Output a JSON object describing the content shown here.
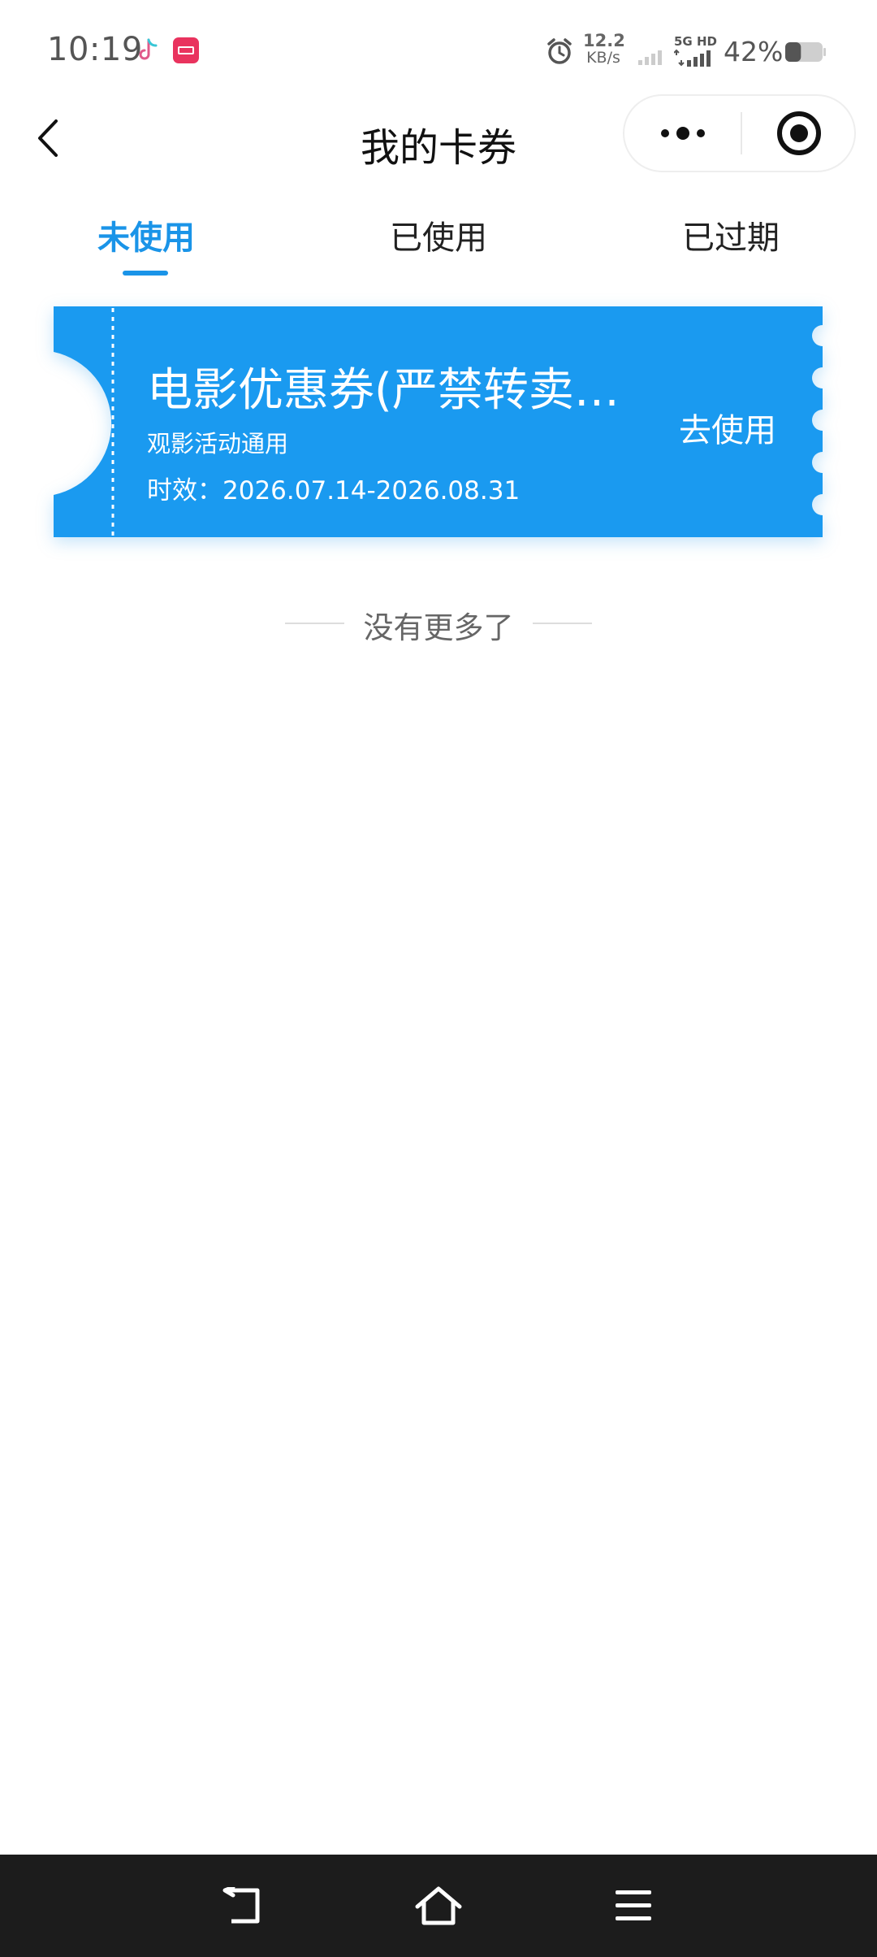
{
  "status_bar": {
    "time": "10:19",
    "net_speed_value": "12.2",
    "net_speed_unit": "KB/s",
    "network_label": "5G HD",
    "battery_percent": "42%",
    "battery_level": 0.42,
    "icons": [
      "tiktok-icon",
      "app-icon",
      "alarm-icon",
      "signal-icon",
      "network-signal-icon",
      "battery-icon"
    ]
  },
  "nav": {
    "title": "我的卡券",
    "back_icon": "chevron-left-icon",
    "more_icon": "more-dots-icon",
    "close_icon": "target-close-icon"
  },
  "tabs": [
    {
      "label": "未使用",
      "active": true
    },
    {
      "label": "已使用",
      "active": false
    },
    {
      "label": "已过期",
      "active": false
    }
  ],
  "coupon": {
    "title": "电影优惠券(严禁转卖…",
    "subtitle": "观影活动通用",
    "validity": "时效：2026.07.14-2026.08.31",
    "action": "去使用",
    "color": "#1a9af0"
  },
  "list_end_text": "没有更多了",
  "system_nav": {
    "back_icon": "back-icon",
    "home_icon": "home-icon",
    "menu_icon": "menu-icon"
  },
  "colors": {
    "accent": "#1a94e8",
    "coupon_bg": "#1a9af0",
    "nav_bar_bg": "#1c1c1c"
  }
}
